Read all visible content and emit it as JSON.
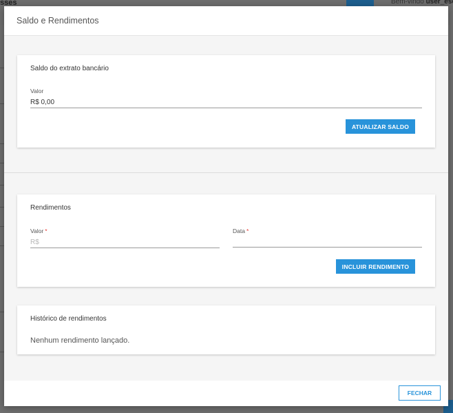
{
  "background": {
    "left_text": "sses",
    "welcome_prefix": "Bem-vindo ",
    "welcome_user": "user_escola"
  },
  "modal": {
    "title": "Saldo e Rendimentos",
    "saldo": {
      "title": "Saldo do extrato bancário",
      "field_label": "Valor",
      "field_value": "R$ 0,00",
      "button_label": "ATUALIZAR SALDO"
    },
    "rendimentos": {
      "title": "Rendimentos",
      "valor_label": "Valor",
      "valor_placeholder": "R$",
      "data_label": "Data",
      "required_mark": "*",
      "button_label": "INCLUIR RENDIMENTO"
    },
    "historico": {
      "title": "Histórico de rendimentos",
      "empty_text": "Nenhum rendimento lançado."
    },
    "footer": {
      "close_label": "FECHAR"
    }
  },
  "colors": {
    "primary": "#2893da",
    "required": "#e53935",
    "overlay": "#6f6f6f"
  }
}
